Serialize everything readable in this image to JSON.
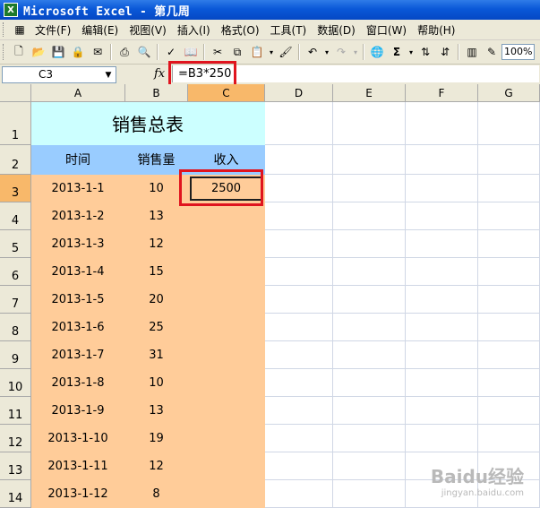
{
  "window": {
    "title": "Microsoft Excel - 第几周",
    "icon": "excel-icon"
  },
  "menu": [
    "文件(F)",
    "编辑(E)",
    "视图(V)",
    "插入(I)",
    "格式(O)",
    "工具(T)",
    "数据(D)",
    "窗口(W)",
    "帮助(H)"
  ],
  "toolbar": {
    "zoom": "100%"
  },
  "formula_bar": {
    "name_box": "C3",
    "fx_label": "fx",
    "formula": "=B3*250"
  },
  "columns": [
    "A",
    "B",
    "C",
    "D",
    "E",
    "F",
    "G"
  ],
  "rows": [
    "1",
    "2",
    "3",
    "4",
    "5",
    "6",
    "7",
    "8",
    "9",
    "10",
    "11",
    "12",
    "13",
    "14"
  ],
  "sheet": {
    "title": "销售总表",
    "headers": [
      "时间",
      "销售量",
      "收入"
    ],
    "records": [
      {
        "date": "2013-1-1",
        "qty": "10",
        "income": "2500"
      },
      {
        "date": "2013-1-2",
        "qty": "13",
        "income": ""
      },
      {
        "date": "2013-1-3",
        "qty": "12",
        "income": ""
      },
      {
        "date": "2013-1-4",
        "qty": "15",
        "income": ""
      },
      {
        "date": "2013-1-5",
        "qty": "20",
        "income": ""
      },
      {
        "date": "2013-1-6",
        "qty": "25",
        "income": ""
      },
      {
        "date": "2013-1-7",
        "qty": "31",
        "income": ""
      },
      {
        "date": "2013-1-8",
        "qty": "10",
        "income": ""
      },
      {
        "date": "2013-1-9",
        "qty": "13",
        "income": ""
      },
      {
        "date": "2013-1-10",
        "qty": "19",
        "income": ""
      },
      {
        "date": "2013-1-11",
        "qty": "12",
        "income": ""
      },
      {
        "date": "2013-1-12",
        "qty": "8",
        "income": ""
      }
    ]
  },
  "watermark": {
    "brand": "Baidu经验",
    "url": "jingyan.baidu.com"
  },
  "colors": {
    "title_fill": "#ccffff",
    "header_fill": "#99ccff",
    "data_fill": "#ffcc99",
    "highlight": "#e0141e"
  }
}
